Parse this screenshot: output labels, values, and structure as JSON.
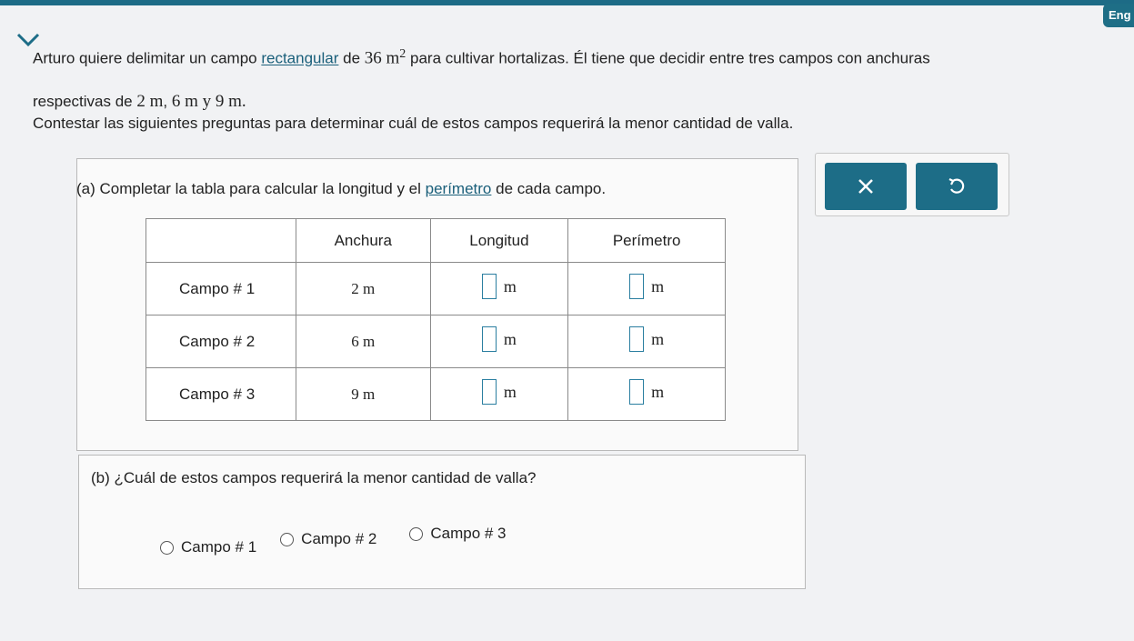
{
  "header": {
    "lang_badge": "Eng"
  },
  "problem": {
    "p1": {
      "t1": "Arturo quiere delimitar un campo ",
      "link": "rectangular",
      "t2": " de ",
      "area": "36 m",
      "exp": "2",
      "t3": " para cultivar hortalizas. Él tiene que decidir entre tres campos con anchuras"
    },
    "p2": {
      "t1": "respectivas de ",
      "w1": "2 m",
      "sep1": ", ",
      "w2": "6 m",
      "t2": " y ",
      "w3": "9 m",
      "t3": "."
    },
    "p3": "Contestar las siguientes preguntas para determinar cuál de estos campos requerirá la menor cantidad de valla."
  },
  "part_a": {
    "t1": "(a) Completar la tabla para calcular la longitud y el ",
    "link": "perímetro",
    "t2": " de cada campo.",
    "table": {
      "headers": [
        "Anchura",
        "Longitud",
        "Perímetro"
      ],
      "rows": [
        {
          "label": "Campo # 1",
          "width": "2 m",
          "len_unit": "m",
          "per_unit": "m"
        },
        {
          "label": "Campo # 2",
          "width": "6 m",
          "len_unit": "m",
          "per_unit": "m"
        },
        {
          "label": "Campo # 3",
          "width": "9 m",
          "len_unit": "m",
          "per_unit": "m"
        }
      ]
    }
  },
  "toolbar": {
    "clear_icon": "close-icon",
    "undo_icon": "undo-icon"
  },
  "part_b": {
    "question": "(b) ¿Cuál de estos campos requerirá la menor cantidad de valla?",
    "options": [
      "Campo # 1",
      "Campo # 2",
      "Campo # 3"
    ]
  },
  "colors": {
    "accent": "#1d6d87",
    "link": "#1a5f7a"
  }
}
